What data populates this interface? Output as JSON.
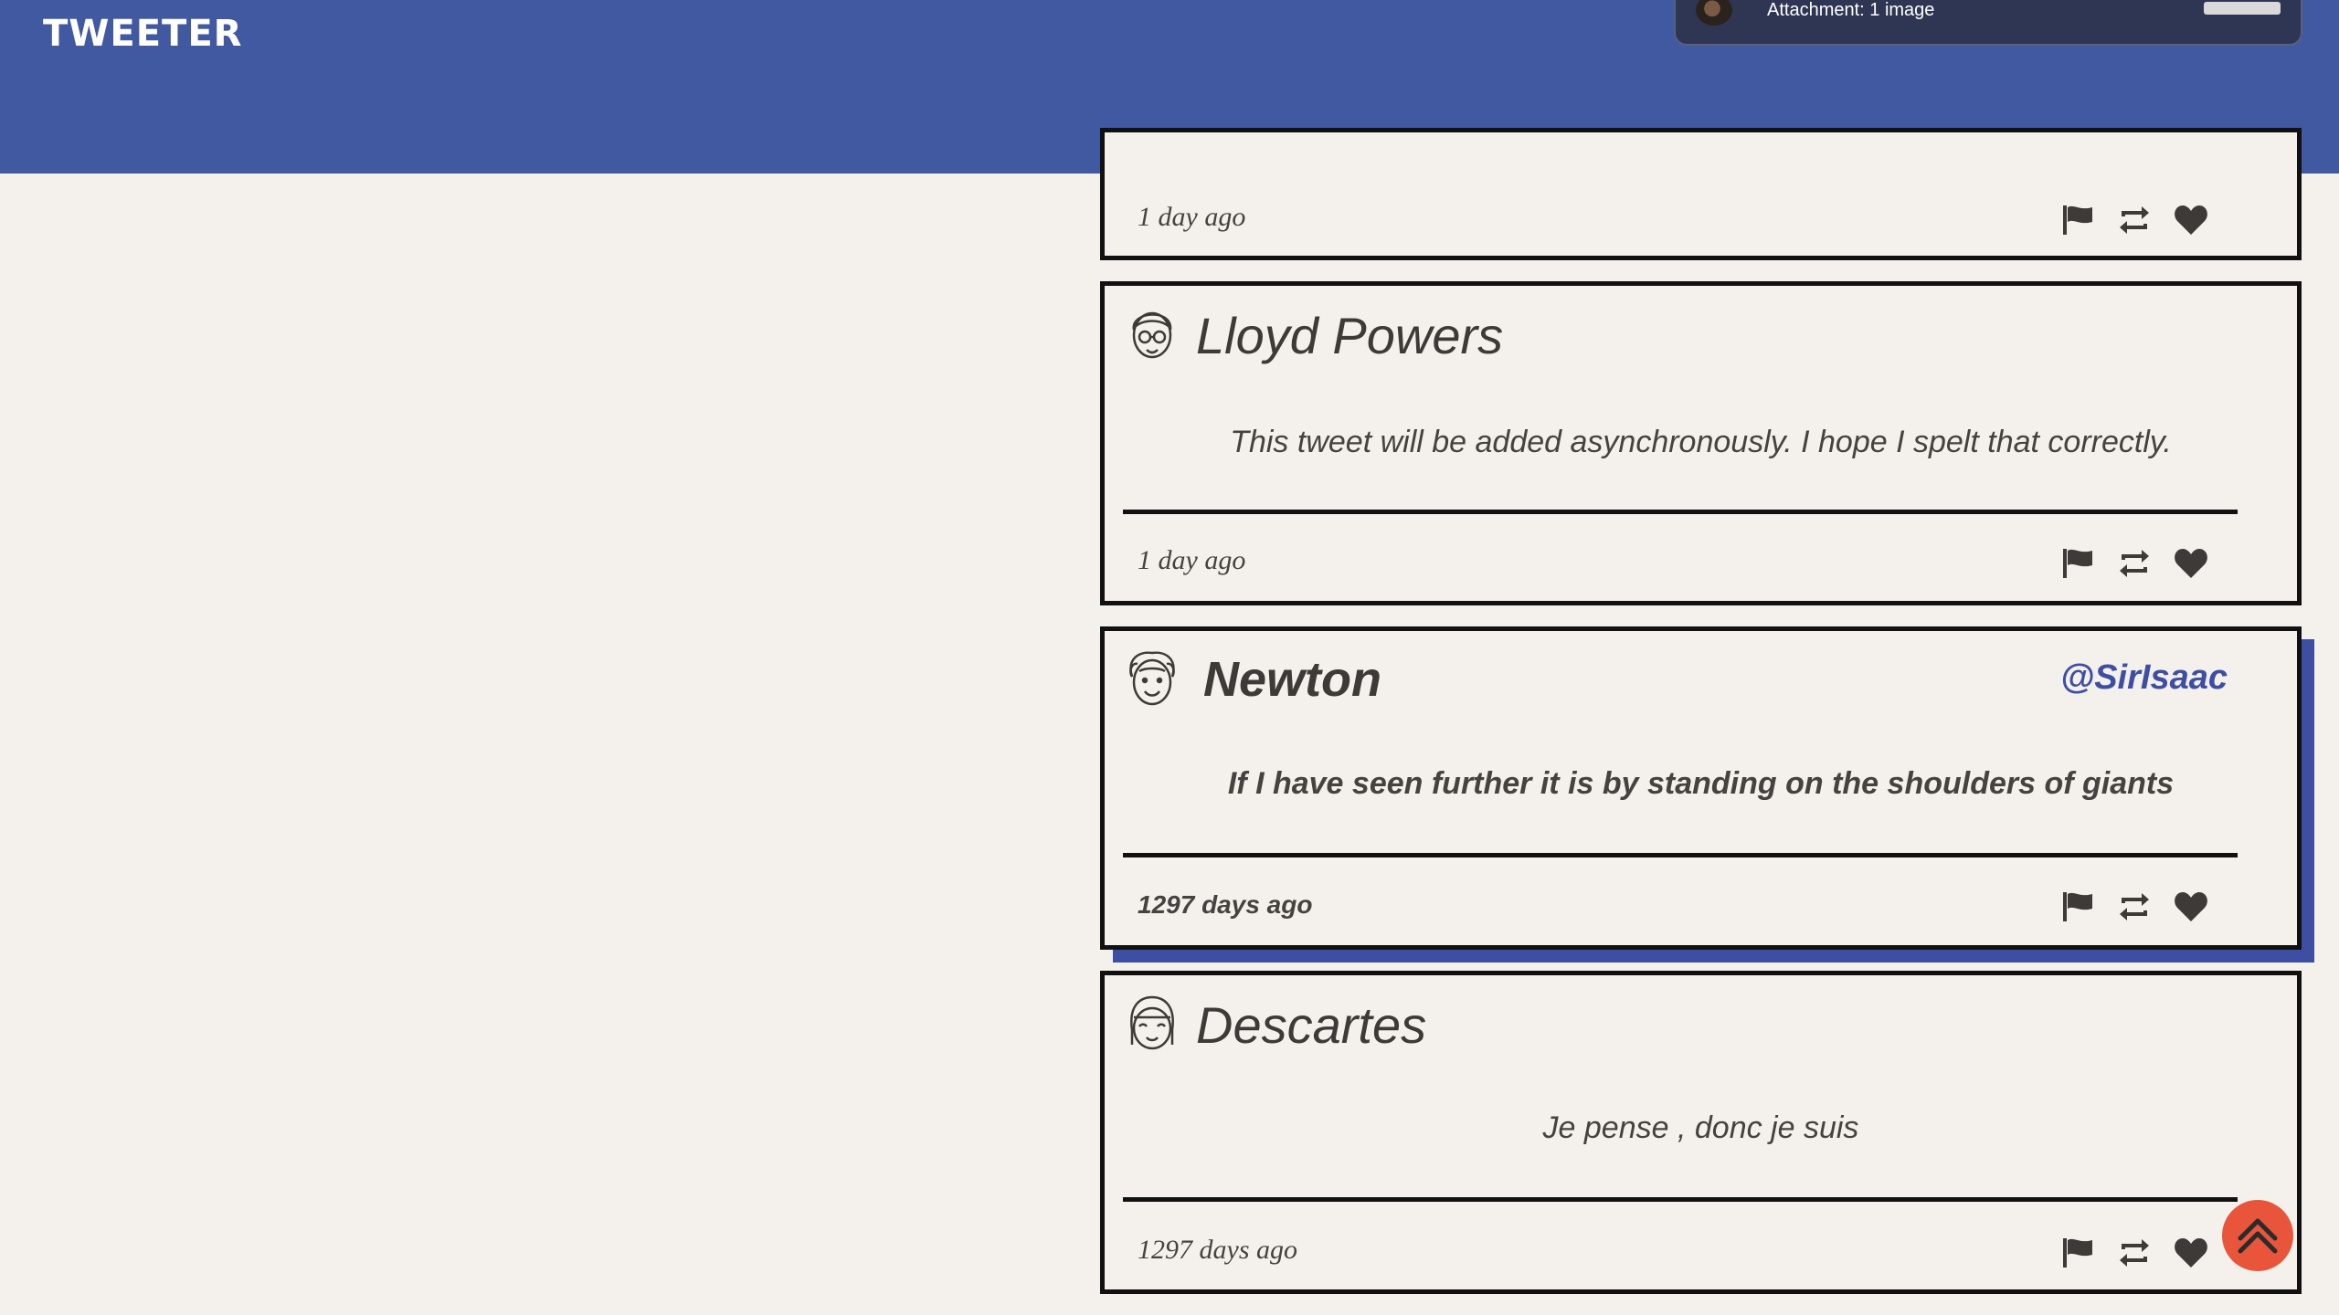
{
  "app": {
    "title": "TWEETER"
  },
  "notification": {
    "text": "Attachment: 1 image"
  },
  "tweets": [
    {
      "name": "",
      "handle": "",
      "text": "",
      "time": "1 day ago"
    },
    {
      "name": "Lloyd Powers",
      "handle": "",
      "text": "This tweet will be added asynchronously. I hope I spelt that correctly.",
      "time": "1 day ago"
    },
    {
      "name": "Newton",
      "handle": "@SirIsaac",
      "text": "If I have seen further it is by standing on the shoulders of giants",
      "time": "1297 days ago"
    },
    {
      "name": "Descartes",
      "handle": "",
      "text": "Je pense , donc je suis",
      "time": "1297 days ago"
    }
  ],
  "icons": {
    "flag": "flag-icon",
    "retweet": "retweet-icon",
    "like": "heart-icon",
    "scroll_top": "double-chevron-up-icon"
  },
  "colors": {
    "header": "#4159a0",
    "accent": "#3e4fa3",
    "scroll_button": "#e8553b",
    "background": "#f4f1ec"
  }
}
